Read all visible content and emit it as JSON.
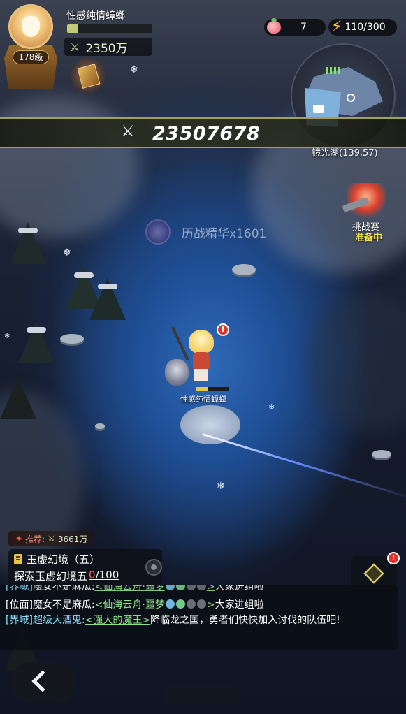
{
  "player": {
    "name": "性感纯情蟑螂",
    "level": "178级",
    "power": "2350万",
    "xp_fraction": 0.12
  },
  "resources": {
    "peach": "7",
    "energy": "110/300"
  },
  "map": {
    "location": "镜光湖(139,57)"
  },
  "combat_power": "23507678",
  "challenge": {
    "title": "挑战赛",
    "status": "准备中"
  },
  "loot_toast": "历战精华x1601",
  "hero": {
    "name": "性感纯情蟑螂",
    "hp_fraction": 0.35,
    "alert": "!"
  },
  "recommend": {
    "label": "推荐:",
    "power": "3661万"
  },
  "quest": {
    "title": "玉虚幻境（五）",
    "task": "探索玉虚幻境五",
    "current": "0",
    "total": "/100"
  },
  "box_alert": "!",
  "chat": [
    {
      "tag": "[界域]",
      "user": "魔女不是麻瓜:",
      "link": "<仙海云舟·噩梦",
      "link_end": ">",
      "text": "大家进组啦"
    },
    {
      "tag": "[位面]",
      "user": "魔女不是麻瓜:",
      "link": "<仙海云舟·噩梦",
      "link_end": ">",
      "text": "大家进组啦"
    },
    {
      "tag": "[界域]",
      "user": "超级大酒鬼:",
      "link": "<强大的魔王>",
      "text": "降临龙之国，勇者们快快加入讨伐的队伍吧!"
    }
  ],
  "icons": {
    "power": "crossed-swords-icon",
    "energy": "lightning-bolt-icon",
    "peach": "peach-icon",
    "back": "chevron-left-icon",
    "box": "cube-box-icon"
  },
  "colors": {
    "banner_border": "#9fa35a",
    "status_yellow": "#f3e24b",
    "chat_tag": "#8be0ff",
    "chat_link": "#8fe08a",
    "progress_red": "#f36b5a"
  }
}
